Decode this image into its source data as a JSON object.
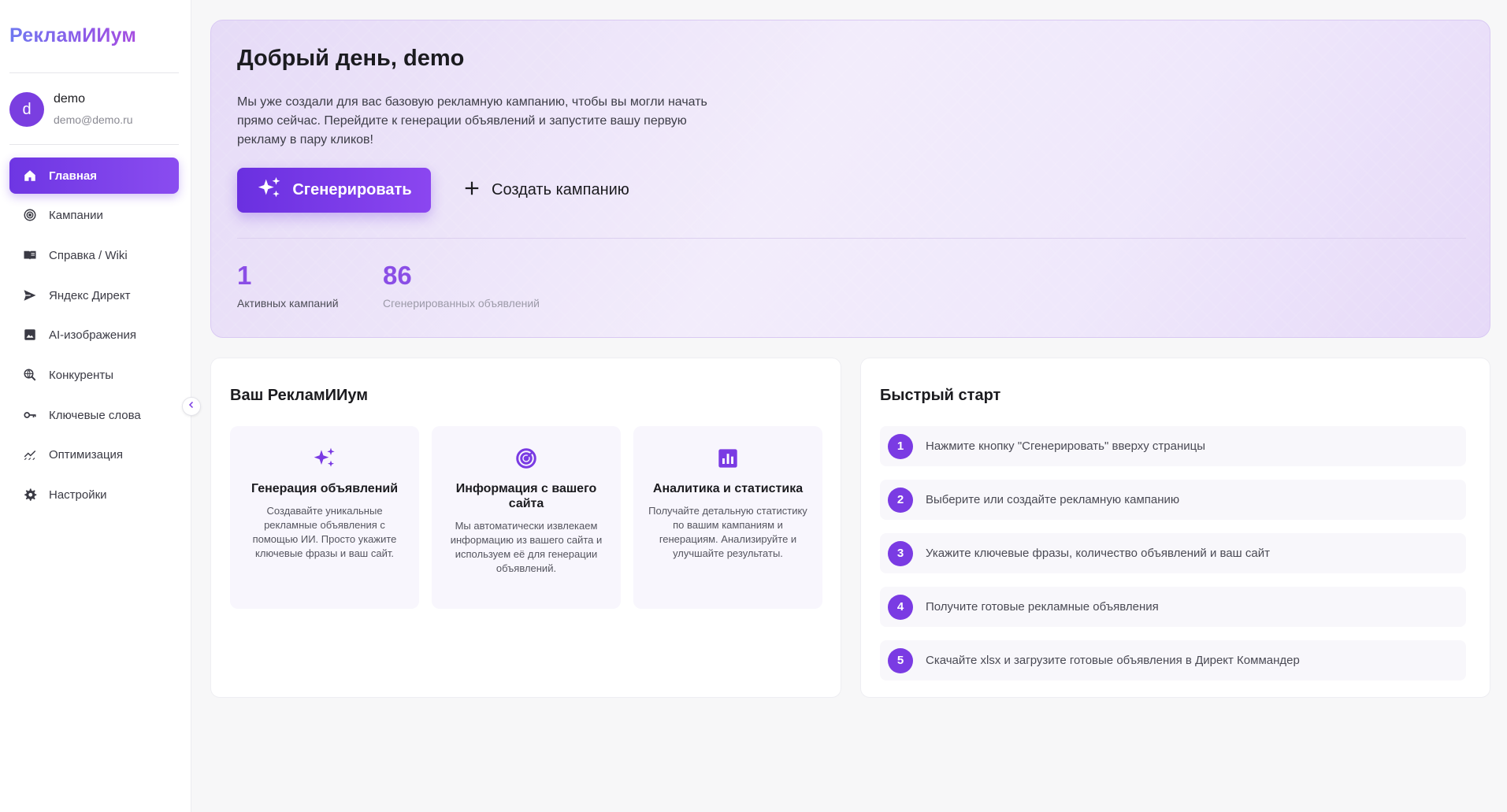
{
  "brand": {
    "name": "РекламИИум"
  },
  "user": {
    "initial": "d",
    "name": "demo",
    "email": "demo@demo.ru"
  },
  "nav": {
    "items": [
      {
        "label": "Главная",
        "icon": "home-icon",
        "active": true
      },
      {
        "label": "Кампании",
        "icon": "target-icon"
      },
      {
        "label": "Справка / Wiki",
        "icon": "book-icon"
      },
      {
        "label": "Яндекс Директ",
        "icon": "send-icon"
      },
      {
        "label": "AI-изображения",
        "icon": "image-icon"
      },
      {
        "label": "Конкуренты",
        "icon": "search-globe-icon"
      },
      {
        "label": "Ключевые слова",
        "icon": "key-icon"
      },
      {
        "label": "Оптимизация",
        "icon": "chart-line-icon"
      },
      {
        "label": "Настройки",
        "icon": "gear-icon"
      }
    ]
  },
  "hero": {
    "title": "Добрый день, demo",
    "text": "Мы уже создали для вас базовую рекламную кампанию, чтобы вы могли начать прямо сейчас. Перейдите к генерации объявлений и запустите вашу первую рекламу в пару кликов!",
    "generate_label": "Сгенерировать",
    "create_label": "Создать кампанию",
    "stats": [
      {
        "value": "1",
        "label": "Активных кампаний"
      },
      {
        "value": "86",
        "label": "Сгенерированных объявлений"
      }
    ]
  },
  "features": {
    "title": "Ваш РекламИИум",
    "items": [
      {
        "icon": "sparkles-icon",
        "title": "Генерация объявлений",
        "desc": "Создавайте уникальные рекламные объявления с помощью ИИ. Просто укажите ключевые фразы и ваш сайт."
      },
      {
        "icon": "target-icon",
        "title": "Информация с вашего сайта",
        "desc": "Мы автоматически извлекаем информацию из вашего сайта и используем её для генерации объявлений."
      },
      {
        "icon": "bar-chart-icon",
        "title": "Аналитика и статистика",
        "desc": "Получайте детальную статистику по вашим кампаниям и генерациям. Анализируйте и улучшайте результаты."
      }
    ]
  },
  "quickstart": {
    "title": "Быстрый старт",
    "steps": [
      {
        "num": "1",
        "text": "Нажмите кнопку \"Сгенерировать\" вверху страницы"
      },
      {
        "num": "2",
        "text": "Выберите или создайте рекламную кампанию"
      },
      {
        "num": "3",
        "text": "Укажите ключевые фразы, количество объявлений и ваш сайт"
      },
      {
        "num": "4",
        "text": "Получите готовые рекламные объявления"
      },
      {
        "num": "5",
        "text": "Скачайте xlsx и загрузите готовые объявления в Директ Коммандер"
      }
    ]
  },
  "colors": {
    "accent": "#7a3be3",
    "accent_light": "#8a4ee6",
    "hero_bg": "#efe8fb"
  }
}
